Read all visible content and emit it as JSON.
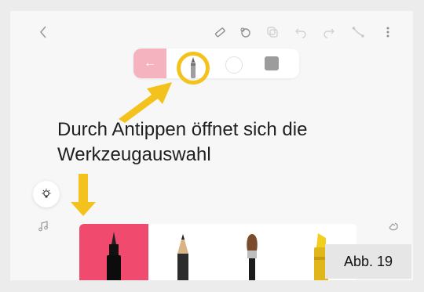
{
  "caption": {
    "line1": "Durch Antippen öffnet sich die",
    "line2": "Werkzeugauswahl"
  },
  "figure_label": "Abb. 19",
  "colors": {
    "highlight": "#f4c21c",
    "tray_active": "#f04a6e",
    "back_button": "#f5b3bf"
  },
  "toolbar_icons": [
    "back-icon",
    "ruler-icon",
    "lasso-icon",
    "copy-icon",
    "undo-icon",
    "redo-icon",
    "path-icon",
    "more-icon"
  ],
  "tray_tools": [
    "fineliner",
    "pencil",
    "brush",
    "marker"
  ]
}
